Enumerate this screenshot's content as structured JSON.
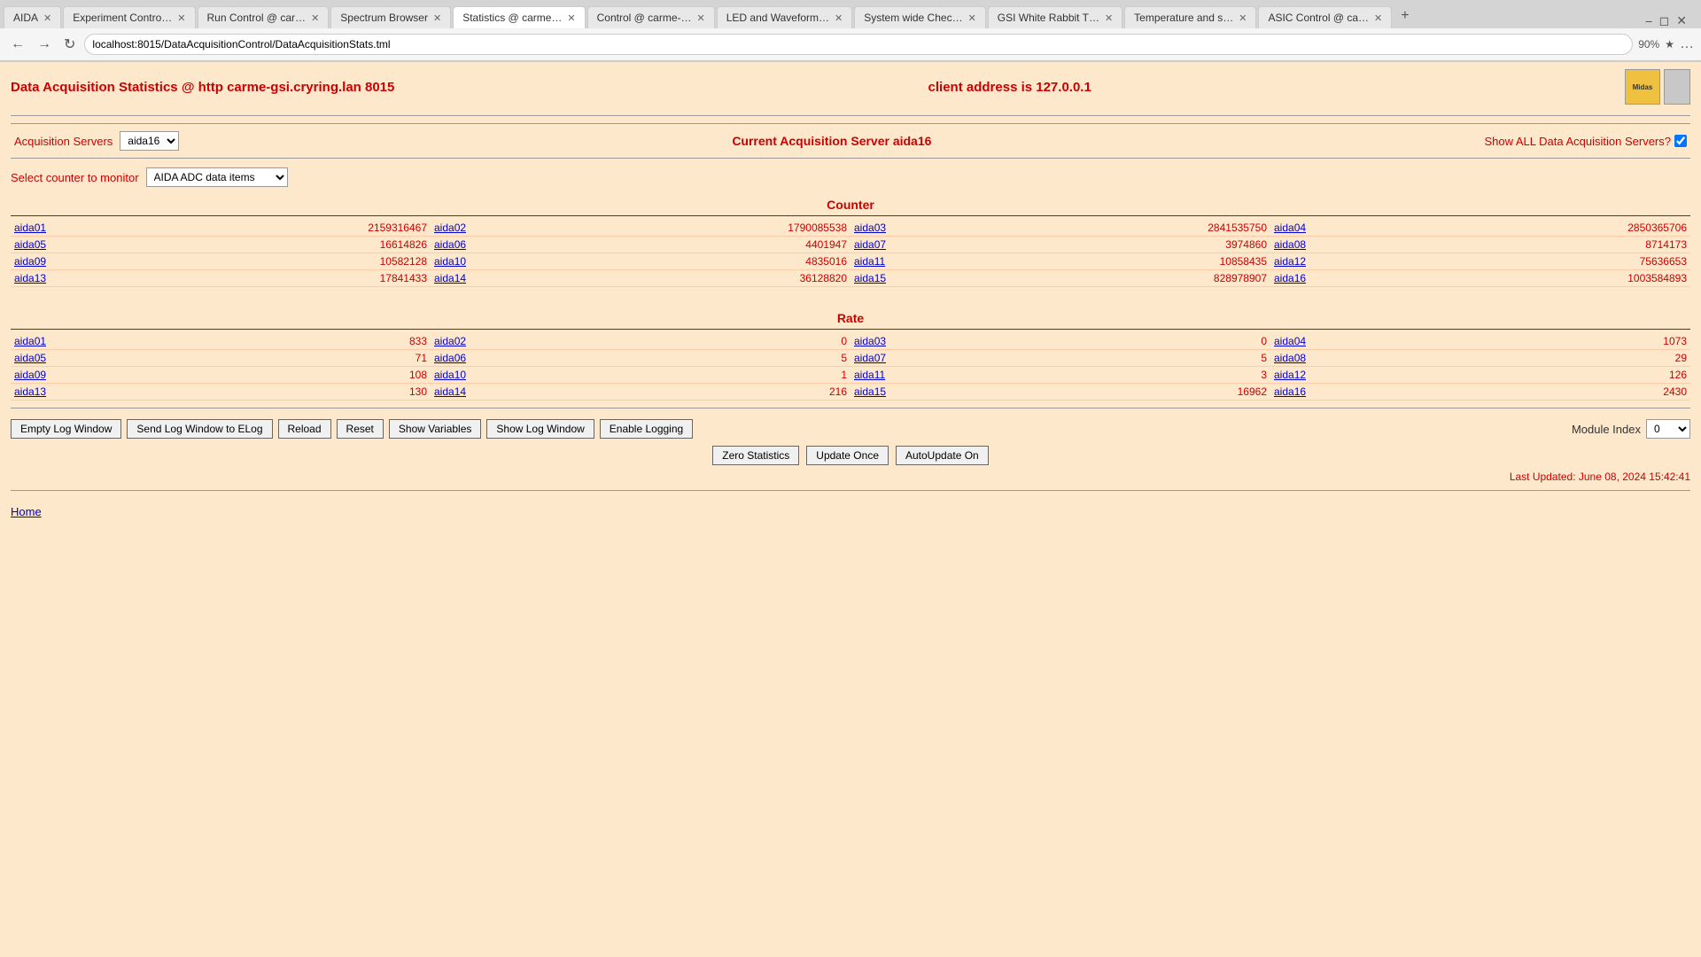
{
  "browser": {
    "tabs": [
      {
        "id": "aida",
        "label": "AIDA",
        "active": false
      },
      {
        "id": "experiment",
        "label": "Experiment Contro…",
        "active": false
      },
      {
        "id": "run",
        "label": "Run Control @ car…",
        "active": false
      },
      {
        "id": "spectrum",
        "label": "Spectrum Browser",
        "active": false
      },
      {
        "id": "statistics",
        "label": "Statistics @ carme…",
        "active": true
      },
      {
        "id": "control",
        "label": "Control @ carme-…",
        "active": false
      },
      {
        "id": "led",
        "label": "LED and Waveform…",
        "active": false
      },
      {
        "id": "syswide",
        "label": "System wide Chec…",
        "active": false
      },
      {
        "id": "gsi",
        "label": "GSI White Rabbit T…",
        "active": false
      },
      {
        "id": "temperature",
        "label": "Temperature and s…",
        "active": false
      },
      {
        "id": "asic",
        "label": "ASIC Control @ ca…",
        "active": false
      }
    ],
    "address": "localhost:8015/DataAcquisitionControl/DataAcquisitionStats.tml",
    "zoom": "90%"
  },
  "page": {
    "title": "Data Acquisition Statistics @ http carme-gsi.cryring.lan 8015",
    "client_address_label": "client address is 127.0.0.1",
    "acquisition_server_label": "Acquisition Servers",
    "acquisition_server_selected": "aida16",
    "current_server": "Current Acquisition Server aida16",
    "show_all_label": "Show ALL Data Acquisition Servers?",
    "select_counter_label": "Select counter to monitor",
    "counter_option": "AIDA ADC data items",
    "counter_heading": "Counter",
    "rate_heading": "Rate",
    "counter_data": [
      {
        "name": "aida01",
        "value": "2159316467"
      },
      {
        "name": "aida02",
        "value": "1790085538"
      },
      {
        "name": "aida03",
        "value": "2841535750"
      },
      {
        "name": "aida04",
        "value": "2850365706"
      },
      {
        "name": "aida05",
        "value": "16614826"
      },
      {
        "name": "aida06",
        "value": "4401947"
      },
      {
        "name": "aida07",
        "value": "3974860"
      },
      {
        "name": "aida08",
        "value": "8714173"
      },
      {
        "name": "aida09",
        "value": "10582128"
      },
      {
        "name": "aida10",
        "value": "4835016"
      },
      {
        "name": "aida11",
        "value": "10858435"
      },
      {
        "name": "aida12",
        "value": "75636653"
      },
      {
        "name": "aida13",
        "value": "17841433"
      },
      {
        "name": "aida14",
        "value": "36128820"
      },
      {
        "name": "aida15",
        "value": "828978907"
      },
      {
        "name": "aida16",
        "value": "1003584893"
      }
    ],
    "rate_data": [
      {
        "name": "aida01",
        "value": "833"
      },
      {
        "name": "aida02",
        "value": "0"
      },
      {
        "name": "aida03",
        "value": "0"
      },
      {
        "name": "aida04",
        "value": "1073"
      },
      {
        "name": "aida05",
        "value": "71"
      },
      {
        "name": "aida06",
        "value": "5"
      },
      {
        "name": "aida07",
        "value": "5"
      },
      {
        "name": "aida08",
        "value": "29"
      },
      {
        "name": "aida09",
        "value": "108"
      },
      {
        "name": "aida10",
        "value": "1"
      },
      {
        "name": "aida11",
        "value": "3"
      },
      {
        "name": "aida12",
        "value": "126"
      },
      {
        "name": "aida13",
        "value": "130"
      },
      {
        "name": "aida14",
        "value": "216"
      },
      {
        "name": "aida15",
        "value": "16962"
      },
      {
        "name": "aida16",
        "value": "2430"
      }
    ],
    "buttons": {
      "empty_log": "Empty Log Window",
      "send_log": "Send Log Window to ELog",
      "reload": "Reload",
      "reset": "Reset",
      "show_variables": "Show Variables",
      "show_log": "Show Log Window",
      "enable_logging": "Enable Logging",
      "zero_statistics": "Zero Statistics",
      "update_once": "Update Once",
      "autoupdate": "AutoUpdate On",
      "module_index_label": "Module Index",
      "module_index_value": "0"
    },
    "last_updated": "Last Updated: June 08, 2024 15:42:41",
    "home_link": "Home"
  }
}
